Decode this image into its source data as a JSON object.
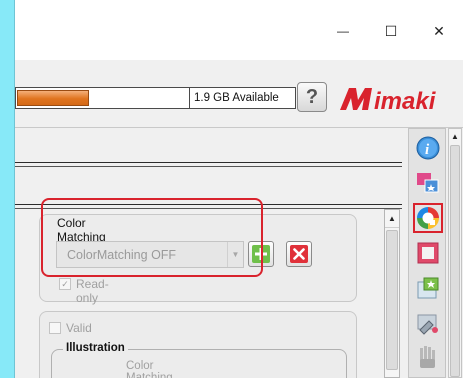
{
  "window": {
    "title": "",
    "minimize_label": "—",
    "maximize_label": "☐",
    "close_label": "✕"
  },
  "toolbar": {
    "storage_used_fraction": 0.42,
    "storage_available": "1.9 GB Available",
    "help_label": "?",
    "logo_text": "Mimaki",
    "logo_color": "#d9232d"
  },
  "color_matching": {
    "group_title": "Color Matching",
    "selected_value": "ColorMatching OFF",
    "add_button_icon": "plus-icon",
    "remove_button_icon": "delete-x-icon",
    "readonly_label": "Read-only",
    "readonly_checked": true,
    "highlight_color": "#d9232d"
  },
  "lower_panel": {
    "valid_label": "Valid",
    "valid_checked": false,
    "illustration_title": "Illustration",
    "method_label": "Color Matching Method"
  },
  "side_tools": [
    {
      "name": "info-icon"
    },
    {
      "name": "layout-icon"
    },
    {
      "name": "color-matching-icon",
      "selected": true
    },
    {
      "name": "frame-icon"
    },
    {
      "name": "image-add-icon"
    },
    {
      "name": "cutter-icon"
    },
    {
      "name": "hand-tool-icon"
    }
  ]
}
